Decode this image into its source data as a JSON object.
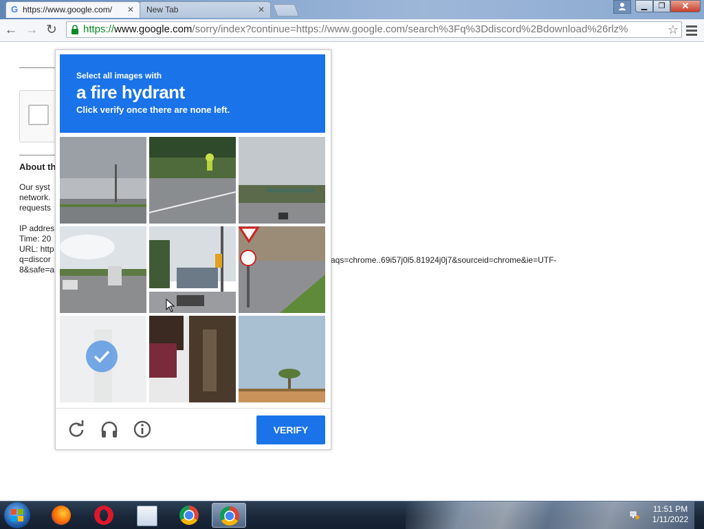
{
  "browser": {
    "tabs": [
      {
        "title": "https://www.google.com/",
        "active": true
      },
      {
        "title": "New Tab",
        "active": false
      }
    ],
    "url_scheme": "https://",
    "url_host": "www.google.com",
    "url_rest": "/sorry/index?continue=https://www.google.com/search%3Fq%3Ddiscord%2Bdownload%26rlz%",
    "nav": {
      "back": "←",
      "forward": "→",
      "reload": "↻"
    },
    "icons": [
      "google-favicon",
      "lock-icon",
      "star-icon",
      "menu-icon",
      "user-icon"
    ]
  },
  "page": {
    "about_heading": "About th",
    "para1": [
      "Our syst",
      "network.",
      "requests"
    ],
    "para2": [
      "IP addres",
      "Time: 20",
      "URL: http",
      "q=discor",
      "8&safe=a"
    ],
    "url_tail": "aqs=chrome..69i57j0l5.81924j0j7&sourceid=chrome&ie=UTF-"
  },
  "captcha": {
    "instruction_small": "Select all images with",
    "target": "a fire hydrant",
    "instruction_sub": "Click verify once there are none left.",
    "verify_label": "VERIFY",
    "tiles": [
      {
        "scene": "cloudy-road",
        "selected": false
      },
      {
        "scene": "cyclist-road",
        "selected": false
      },
      {
        "scene": "highway-overpass",
        "selected": false
      },
      {
        "scene": "highway-truck",
        "selected": false
      },
      {
        "scene": "intersection-traffic-light",
        "selected": false
      },
      {
        "scene": "yield-sign-corner",
        "selected": false
      },
      {
        "scene": "faded-selected",
        "selected": true
      },
      {
        "scene": "tree-trunk-car",
        "selected": false
      },
      {
        "scene": "palm-tree-wall",
        "selected": false
      }
    ],
    "footer_icons": [
      "reload-icon",
      "audio-icon",
      "info-icon"
    ],
    "accent": "#1a73e8"
  },
  "taskbar": {
    "apps": [
      "windows-start",
      "firefox-icon",
      "opera-icon",
      "notepad-icon",
      "chrome-icon",
      "chrome-active-icon"
    ],
    "time": "11:51 PM",
    "date": "1/11/2022"
  }
}
